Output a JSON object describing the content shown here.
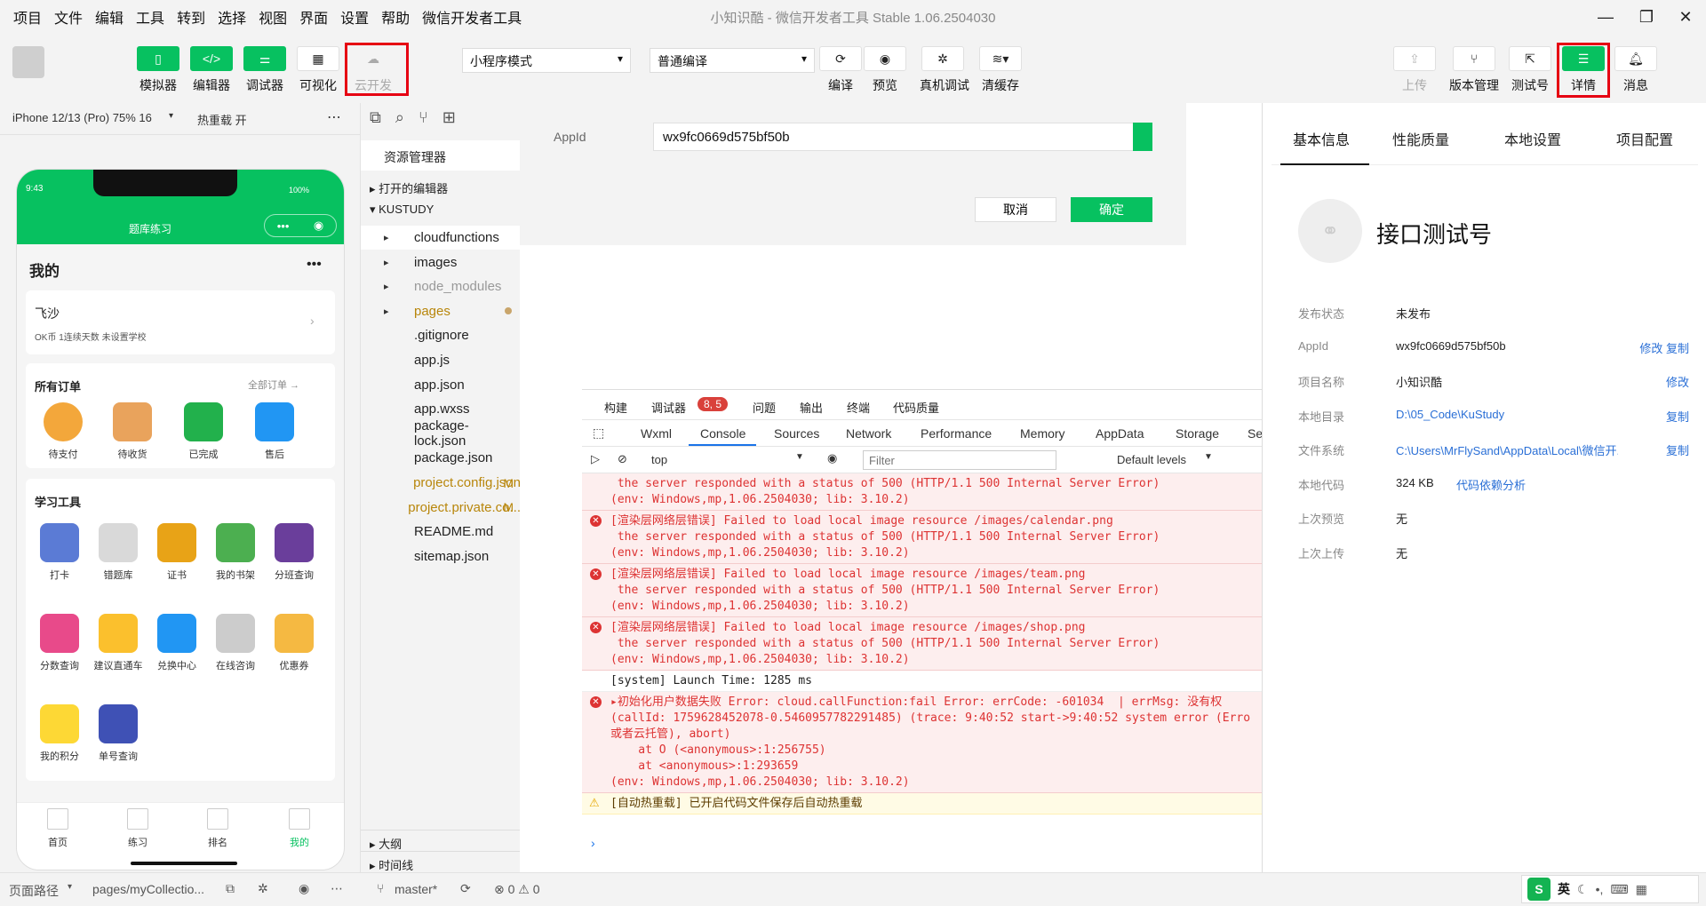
{
  "menubar": [
    "项目",
    "文件",
    "编辑",
    "工具",
    "转到",
    "选择",
    "视图",
    "界面",
    "设置",
    "帮助",
    "微信开发者工具"
  ],
  "window_title": "小知识酷 - 微信开发者工具 Stable 1.06.2504030",
  "toolbar": {
    "simulator": "模拟器",
    "editor": "编辑器",
    "debugger": "调试器",
    "visual": "可视化",
    "cloud": "云开发",
    "mode_select": "小程序模式",
    "compile_select": "普通编译",
    "compile": "编译",
    "preview": "预览",
    "real_debug": "真机调试",
    "clear_cache": "清缓存",
    "upload": "上传",
    "version": "版本管理",
    "test_id": "测试号",
    "details": "详情",
    "messages": "消息"
  },
  "simulator": {
    "device": "iPhone 12/13 (Pro) 75% 16",
    "hot_reload": "热重载 开",
    "status_time": "9:43",
    "battery": "100%",
    "nav_title": "题库练习",
    "page_title": "我的",
    "user_name": "飞沙",
    "user_meta": "OK币  1连续天数  未设置学校",
    "orders_title": "所有订单",
    "orders_all": "全部订单 →",
    "orders": [
      "待支付",
      "待收货",
      "已完成",
      "售后"
    ],
    "tools_title": "学习工具",
    "tools": [
      "打卡",
      "错题库",
      "证书",
      "我的书架",
      "分班查询",
      "分数查询",
      "建议直通车",
      "兑换中心",
      "在线咨询",
      "优惠券",
      "我的积分",
      "单号查询"
    ],
    "tabs": [
      "首页",
      "练习",
      "排名",
      "我的"
    ]
  },
  "explorer": {
    "title": "资源管理器",
    "open_editors": "打开的编辑器",
    "project": "KUSTUDY",
    "files": [
      {
        "name": "cloudfunctions",
        "badge": ""
      },
      {
        "name": "images",
        "badge": ""
      },
      {
        "name": "node_modules",
        "badge": ""
      },
      {
        "name": "pages",
        "badge": ""
      },
      {
        "name": ".gitignore",
        "badge": ""
      },
      {
        "name": "app.js",
        "badge": ""
      },
      {
        "name": "app.json",
        "badge": ""
      },
      {
        "name": "app.wxss",
        "badge": ""
      },
      {
        "name": "package-lock.json",
        "badge": ""
      },
      {
        "name": "package.json",
        "badge": ""
      },
      {
        "name": "project.config.json",
        "badge": "M"
      },
      {
        "name": "project.private.co...",
        "badge": "M"
      },
      {
        "name": "README.md",
        "badge": ""
      },
      {
        "name": "sitemap.json",
        "badge": ""
      }
    ],
    "outline": "大纲",
    "timeline": "时间线"
  },
  "appid_dialog": {
    "label": "AppId",
    "value": "wx9fc0669d575bf50b",
    "cancel": "取消",
    "confirm": "确定"
  },
  "devtools": {
    "top_tabs": [
      "构建",
      "调试器",
      "问题",
      "输出",
      "终端",
      "代码质量"
    ],
    "badge": "8, 5",
    "tabs": [
      "Wxml",
      "Console",
      "Sources",
      "Network",
      "Performance",
      "Memory",
      "AppData",
      "Storage",
      "Se"
    ],
    "context": "top",
    "filter_placeholder": "Filter",
    "levels": "Default levels",
    "logs": [
      {
        "type": "err",
        "lines": [
          " the server responded with a status of 500 (HTTP/1.1 500 Internal Server Error)",
          "(env: Windows,mp,1.06.2504030; lib: 3.10.2)"
        ]
      },
      {
        "type": "err",
        "lines": [
          "[渲染层网络层错误] Failed to load local image resource /images/calendar.png",
          " the server responded with a status of 500 (HTTP/1.1 500 Internal Server Error)",
          "(env: Windows,mp,1.06.2504030; lib: 3.10.2)"
        ]
      },
      {
        "type": "err",
        "lines": [
          "[渲染层网络层错误] Failed to load local image resource /images/team.png",
          " the server responded with a status of 500 (HTTP/1.1 500 Internal Server Error)",
          "(env: Windows,mp,1.06.2504030; lib: 3.10.2)"
        ]
      },
      {
        "type": "err",
        "lines": [
          "[渲染层网络层错误] Failed to load local image resource /images/shop.png",
          " the server responded with a status of 500 (HTTP/1.1 500 Internal Server Error)",
          "(env: Windows,mp,1.06.2504030; lib: 3.10.2)"
        ]
      },
      {
        "type": "sys",
        "lines": [
          "[system] Launch Time: 1285 ms"
        ]
      },
      {
        "type": "err",
        "lines": [
          "▸初始化用户数据失败 Error: cloud.callFunction:fail Error: errCode: -601034  | errMsg: 没有权",
          "(callId: 1759628452078-0.5460957782291485) (trace: 9:40:52 start->9:40:52 system error (Erro",
          "或者云托管), abort)",
          "    at O (<anonymous>:1:256755)",
          "    at <anonymous>:1:293659",
          "(env: Windows,mp,1.06.2504030; lib: 3.10.2)"
        ]
      },
      {
        "type": "warn",
        "lines": [
          "[自动热重载] 已开启代码文件保存后自动热重载"
        ]
      }
    ]
  },
  "details_panel": {
    "tabs": [
      "基本信息",
      "性能质量",
      "本地设置",
      "项目配置"
    ],
    "account_name": "接口测试号",
    "rows": [
      {
        "k": "发布状态",
        "v": "未发布",
        "a": ""
      },
      {
        "k": "AppId",
        "v": "wx9fc0669d575bf50b",
        "a": "修改 复制"
      },
      {
        "k": "项目名称",
        "v": "小知识酷",
        "a": "修改"
      },
      {
        "k": "本地目录",
        "v": "D:\\05_Code\\KuStudy",
        "a": "复制"
      },
      {
        "k": "文件系统",
        "v": "C:\\Users\\MrFlySand\\AppData\\Local\\微信开...",
        "a": "复制"
      },
      {
        "k": "本地代码",
        "v": "324 KB",
        "a": "代码依赖分析"
      },
      {
        "k": "上次预览",
        "v": "无",
        "a": ""
      },
      {
        "k": "上次上传",
        "v": "无",
        "a": ""
      }
    ]
  },
  "statusbar": {
    "page_path_label": "页面路径",
    "page_path": "pages/myCollectio...",
    "branch": "master*",
    "problems": "⊗ 0 ⚠ 0",
    "ime": "英"
  }
}
